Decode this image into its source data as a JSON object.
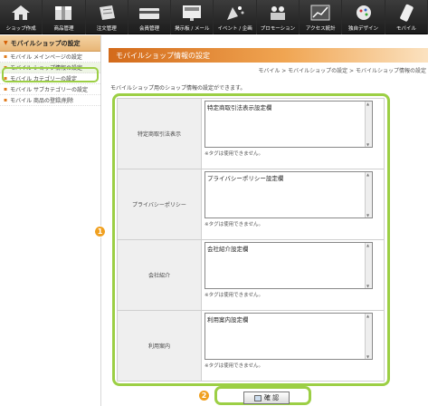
{
  "nav": {
    "items": [
      {
        "label": "ショップ作成",
        "icon": "home-icon"
      },
      {
        "label": "商品管理",
        "icon": "box-icon"
      },
      {
        "label": "注文管理",
        "icon": "order-icon"
      },
      {
        "label": "会員管理",
        "icon": "card-icon"
      },
      {
        "label": "掲示板 / メール",
        "icon": "board-icon"
      },
      {
        "label": "イベント / 企画",
        "icon": "party-icon"
      },
      {
        "label": "プロモーション",
        "icon": "promotion-icon"
      },
      {
        "label": "アクセス統計",
        "icon": "stats-icon"
      },
      {
        "label": "独自デザイン",
        "icon": "design-icon"
      },
      {
        "label": "モバイル",
        "icon": "mobile-icon"
      }
    ]
  },
  "sidebar": {
    "header": "モバイルショップの設定",
    "items": [
      {
        "label": "モバイル メインページの設定"
      },
      {
        "label": "モバイル ショップ情報の設定"
      },
      {
        "label": "モバイル カテゴリーの設定"
      },
      {
        "label": "モバイル サブカテゴリーの設定"
      },
      {
        "label": "モバイル 商品の登録/削除"
      }
    ]
  },
  "main": {
    "title": "モバイルショップ情報の設定",
    "breadcrumb": "モバイル > モバイルショップの設定 > モバイルショップ情報の設定",
    "intro": "モバイルショップ用のショップ情報の設定ができます。",
    "rows": [
      {
        "label": "特定商取引法表示",
        "value": "特定商取引法表示設定欄",
        "note": "※タグは使用できません。"
      },
      {
        "label": "プライバシーポリシー",
        "value": "プライバシーポリシー設定欄",
        "note": "※タグは使用できません。"
      },
      {
        "label": "会社紹介",
        "value": "会社紹介設定欄",
        "note": "※タグは使用できません。"
      },
      {
        "label": "利用案内",
        "value": "利用案内設定欄",
        "note": "※タグは使用できません。"
      }
    ],
    "confirm_label": "確 認",
    "markers": {
      "form": "1",
      "button": "2"
    }
  },
  "colors": {
    "accent_orange": "#f0a020",
    "highlight_green": "#9ccf45"
  }
}
